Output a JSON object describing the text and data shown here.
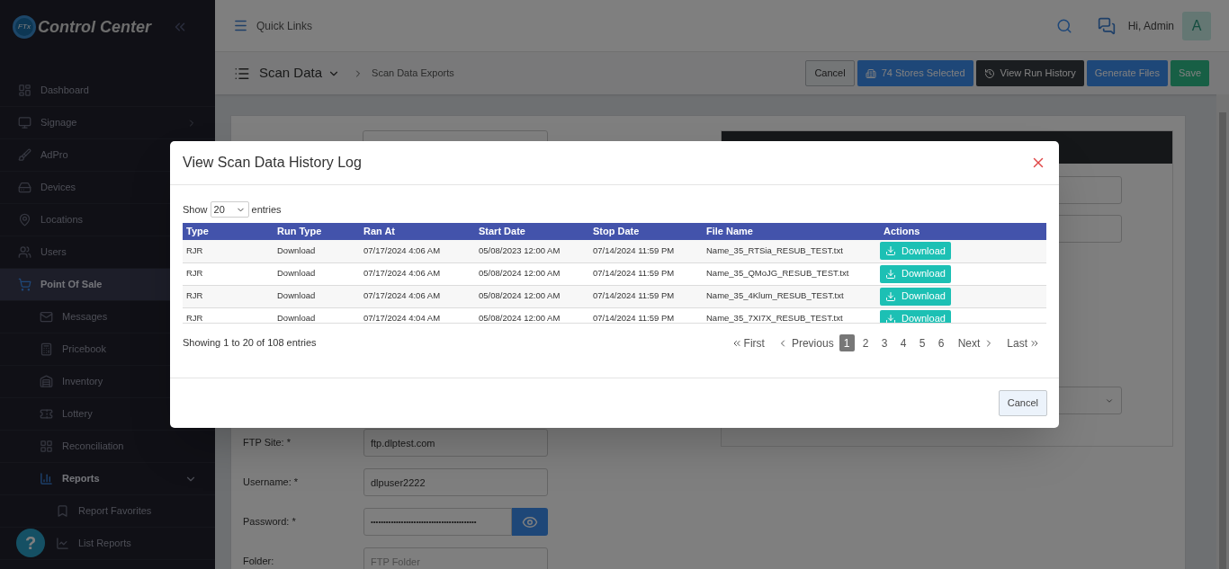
{
  "sidebar": {
    "logo": "Control Center",
    "logo_badge": "FTx",
    "items": [
      {
        "label": "Dashboard",
        "selected": false
      },
      {
        "label": "Signage",
        "selected": false,
        "expanded": false
      },
      {
        "label": "AdPro",
        "selected": false
      },
      {
        "label": "Devices",
        "selected": false
      },
      {
        "label": "Locations",
        "selected": false
      },
      {
        "label": "Users",
        "selected": false
      },
      {
        "label": "Point Of Sale",
        "selected": true,
        "children": [
          {
            "label": "Messages",
            "selected": false
          },
          {
            "label": "Pricebook",
            "selected": false
          },
          {
            "label": "Inventory",
            "selected": false
          },
          {
            "label": "Lottery",
            "selected": false
          },
          {
            "label": "Reconciliation",
            "selected": false
          },
          {
            "label": "Reports",
            "selected": true,
            "expanded": true,
            "children": [
              {
                "label": "Report Favorites",
                "selected": false
              },
              {
                "label": "List Reports",
                "selected": false
              }
            ]
          }
        ]
      }
    ],
    "help": "?"
  },
  "header": {
    "quick_links": "Quick Links",
    "greeting": "Hi, Admin",
    "avatar": "A"
  },
  "toolbar": {
    "title": "Scan Data",
    "breadcrumb": "Scan Data Exports",
    "buttons": [
      {
        "label": "Cancel",
        "kind": "light"
      },
      {
        "label": "74 Stores Selected",
        "kind": "stores"
      },
      {
        "label": "View Run History",
        "kind": "history"
      },
      {
        "label": "Generate Files",
        "kind": "primary"
      },
      {
        "label": "Save",
        "kind": "success"
      }
    ]
  },
  "form": {
    "fields": [
      {
        "label": "FTP Site: *",
        "value": "ftp.dlptest.com"
      },
      {
        "label": "Username: *",
        "value": "dlpuser2222"
      },
      {
        "label": "Password: *",
        "value": "••••••••••••••••••••••••••••••••••••••••••",
        "masked": true
      },
      {
        "label": "Folder:",
        "placeholder": "FTP Folder"
      }
    ]
  },
  "modal": {
    "title": "View Scan Data History Log",
    "show": "Show",
    "page_size": "20",
    "entries": "entries",
    "table": {
      "columns": [
        "Type",
        "Run Type",
        "Ran At",
        "Start Date",
        "Stop Date",
        "File Name",
        "Actions"
      ],
      "rows": [
        [
          "RJR",
          "Download",
          "07/17/2024 4:06 AM",
          "05/08/2023 12:00 AM",
          "07/14/2024 11:59 PM",
          "Name_35_RTSia_RESUB_TEST.txt",
          "Download"
        ],
        [
          "RJR",
          "Download",
          "07/17/2024 4:06 AM",
          "05/08/2024 12:00 AM",
          "07/14/2024 11:59 PM",
          "Name_35_QMoJG_RESUB_TEST.txt",
          "Download"
        ],
        [
          "RJR",
          "Download",
          "07/17/2024 4:06 AM",
          "05/08/2024 12:00 AM",
          "07/14/2024 11:59 PM",
          "Name_35_4Klum_RESUB_TEST.txt",
          "Download"
        ],
        [
          "RJR",
          "Download",
          "07/17/2024 4:04 AM",
          "05/08/2024 12:00 AM",
          "07/14/2024 11:59 PM",
          "Name_35_7XI7X_RESUB_TEST.txt",
          "Download"
        ]
      ]
    },
    "info": "Showing 1 to 20 of 108 entries",
    "pagination": {
      "first": "First",
      "previous": "Previous",
      "pages": [
        {
          "label": "1",
          "selected": true
        },
        {
          "label": "2",
          "selected": false
        },
        {
          "label": "3",
          "selected": false
        },
        {
          "label": "4",
          "selected": false
        },
        {
          "label": "5",
          "selected": false
        },
        {
          "label": "6",
          "selected": false
        }
      ],
      "next": "Next",
      "last": "Last"
    },
    "cancel": "Cancel"
  }
}
